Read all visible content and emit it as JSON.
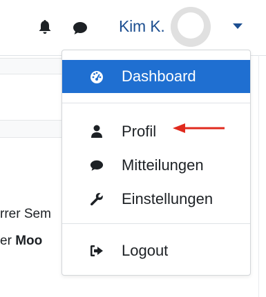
{
  "navbar": {
    "notification_icon": "bell-icon",
    "messages_icon": "chat-bubble-icon",
    "username": "Kim K.",
    "menu_toggle_icon": "caret-down-icon"
  },
  "background": {
    "fragment_line1": "rrer Sem",
    "fragment_line2_prefix": "er ",
    "fragment_line2_bold": "Moo"
  },
  "menu": {
    "items": [
      {
        "label": "Dashboard",
        "icon": "tachometer-icon",
        "active": true
      },
      {
        "label": "Profil",
        "icon": "user-icon",
        "active": false
      },
      {
        "label": "Mitteilungen",
        "icon": "comment-icon",
        "active": false
      },
      {
        "label": "Einstellungen",
        "icon": "wrench-icon",
        "active": false
      },
      {
        "label": "Logout",
        "icon": "sign-out-icon",
        "active": false
      }
    ]
  },
  "annotation": {
    "arrow_target": "Profil",
    "arrow_color": "#e02a1e"
  },
  "colors": {
    "accent": "#1f6fd1",
    "link": "#1d4f91",
    "text": "#1d2125"
  }
}
